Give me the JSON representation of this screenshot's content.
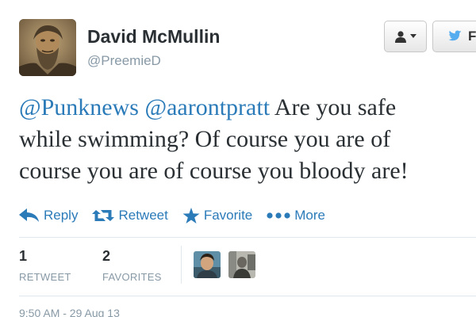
{
  "header": {
    "display_name": "David McMullin",
    "screen_name": "@PreemieD",
    "follow_label": "F"
  },
  "tweet": {
    "mention_1": "@Punknews",
    "mention_2": "@aarontpratt",
    "text_line_1": " Are you safe",
    "text_line_2": "while swimming? Of course you are of",
    "text_line_3": "course you are of course you bloody are!"
  },
  "actions": {
    "reply_label": "Reply",
    "retweet_label": "Retweet",
    "favorite_label": "Favorite",
    "more_label": "More"
  },
  "stats": {
    "retweet_count": "1",
    "retweet_label": "RETWEET",
    "favorites_count": "2",
    "favorites_label": "FAVORITES"
  },
  "timestamp": "9:50 AM - 29 Aug 13",
  "icons": {
    "user": "user-icon",
    "caret": "caret-down-icon",
    "twitter_bird": "twitter-bird-icon",
    "reply": "reply-icon",
    "retweet": "retweet-icon",
    "favorite": "star-icon",
    "more": "more-dots-icon"
  },
  "colors": {
    "link": "#2b7bb9",
    "text": "#292f33",
    "muted": "#8899a6",
    "bird": "#55acee"
  }
}
